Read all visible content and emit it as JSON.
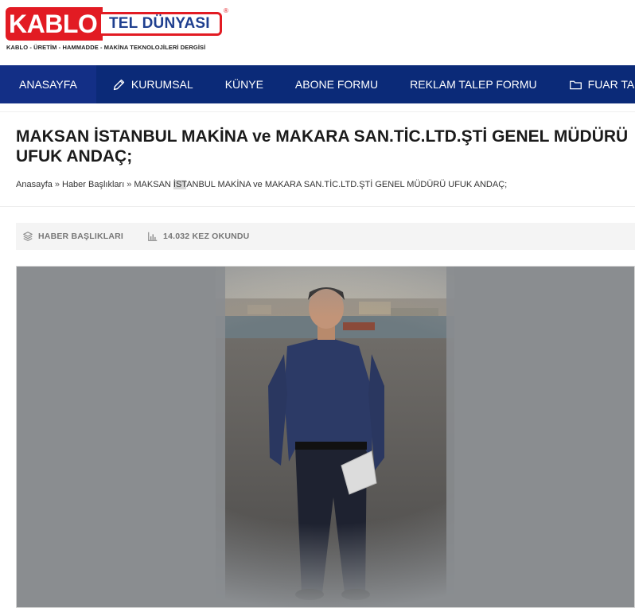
{
  "brand": {
    "kablo": "KABLO",
    "tel": "TEL DÜNYASI",
    "registered": "®",
    "tagline": "KABLO - ÜRETİM - HAMMADDE - MAKİNA TEKNOLOJİLERİ DERGİSİ",
    "colors": {
      "red": "#e21b23",
      "blue": "#1f3f8f",
      "nav": "#0b2a78"
    }
  },
  "nav": {
    "items": [
      {
        "label": "ANASAYFA",
        "icon": ""
      },
      {
        "label": "KURUMSAL",
        "icon": "pencil-icon"
      },
      {
        "label": "KÜNYE",
        "icon": ""
      },
      {
        "label": "ABONE FORMU",
        "icon": ""
      },
      {
        "label": "REKLAM TALEP FORMU",
        "icon": ""
      },
      {
        "label": "FUAR TAKVİMİ",
        "icon": "folder-icon"
      }
    ]
  },
  "article": {
    "title": "MAKSAN İSTANBUL MAKİNA ve MAKARA SAN.TİC.LTD.ŞTİ GENEL MÜDÜRÜ UFUK ANDAÇ;",
    "breadcrumb": {
      "home": "Anasayfa",
      "sep": "»",
      "category": "Haber Başlıkları",
      "current_pre": "MAKSAN ",
      "current_hl": "İST",
      "current_post": "ANBUL MAKİNA ve MAKARA SAN.TİC.LTD.ŞTİ GENEL MÜDÜRÜ UFUK ANDAÇ;"
    },
    "meta": {
      "category": "HABER BAŞLIKLARI",
      "category_icon": "layers-icon",
      "views": "14.032 KEZ OKUNDU",
      "views_icon": "bar-chart-icon"
    },
    "image": {
      "subject": "portrait-photo"
    }
  }
}
